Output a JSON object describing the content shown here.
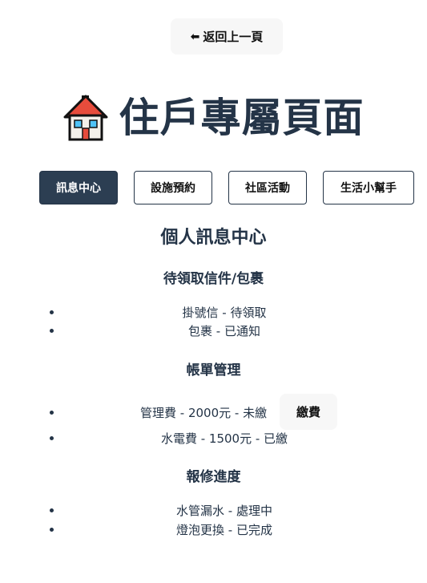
{
  "header": {
    "back_label": "返回上一頁",
    "title": "住戶專屬頁面"
  },
  "tabs": [
    {
      "label": "訊息中心",
      "active": true
    },
    {
      "label": "設施預約",
      "active": false
    },
    {
      "label": "社區活動",
      "active": false
    },
    {
      "label": "生活小幫手",
      "active": false
    }
  ],
  "main": {
    "heading": "個人訊息中心",
    "mail": {
      "heading": "待領取信件/包裹",
      "items": [
        "掛號信 - 待領取",
        "包裹 - 已通知"
      ]
    },
    "bills": {
      "heading": "帳單管理",
      "items": [
        "管理費 - 2000元 - 未繳",
        "水電費 - 1500元 - 已繳"
      ],
      "pay_label": "繳費"
    },
    "repairs": {
      "heading": "報修進度",
      "items": [
        "水管漏水 - 處理中",
        "燈泡更換 - 已完成"
      ]
    }
  },
  "colors": {
    "primary": "#2c3e52",
    "text": "#243447",
    "button_bg": "#f7f7f7"
  }
}
